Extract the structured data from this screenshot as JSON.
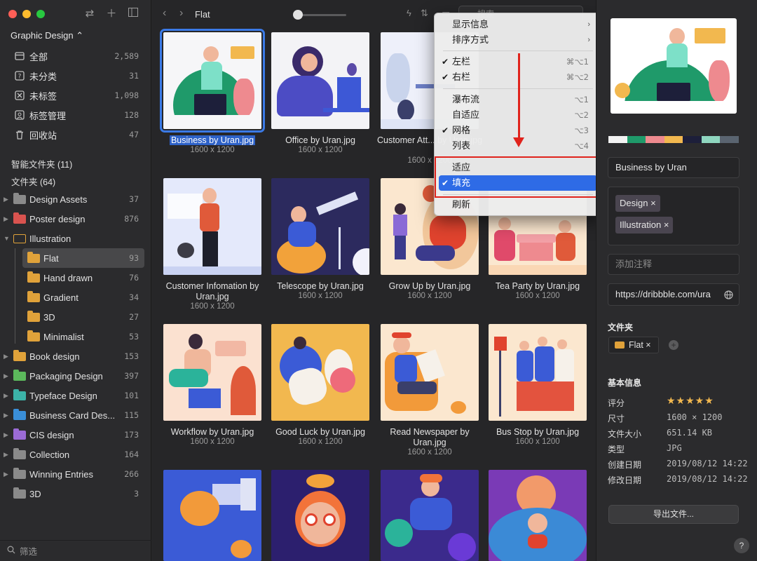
{
  "sidebar": {
    "library": "Graphic Design ⌃",
    "items": [
      {
        "label": "全部",
        "count": "2,589"
      },
      {
        "label": "未分类",
        "count": "31"
      },
      {
        "label": "未标签",
        "count": "1,098"
      },
      {
        "label": "标签管理",
        "count": "128"
      },
      {
        "label": "回收站",
        "count": "47"
      }
    ],
    "smart_folders": "智能文件夹 (11)",
    "folders_title": "文件夹 (64)",
    "folders": [
      {
        "label": "Design Assets",
        "count": "37",
        "color": "#8a8a8a"
      },
      {
        "label": "Poster design",
        "count": "876",
        "color": "#d9534f"
      },
      {
        "label": "Illustration",
        "count": "",
        "color": "#e0a23a"
      },
      {
        "label": "Flat",
        "count": "93",
        "color": "#e0a23a"
      },
      {
        "label": "Hand drawn",
        "count": "76",
        "color": "#e0a23a"
      },
      {
        "label": "Gradient",
        "count": "34",
        "color": "#e0a23a"
      },
      {
        "label": "3D",
        "count": "27",
        "color": "#e0a23a"
      },
      {
        "label": "Minimalist",
        "count": "53",
        "color": "#e0a23a"
      },
      {
        "label": "Book design",
        "count": "153",
        "color": "#e0a23a"
      },
      {
        "label": "Packaging Design",
        "count": "397",
        "color": "#5cb85c"
      },
      {
        "label": "Typeface Design",
        "count": "101",
        "color": "#3cb3a8"
      },
      {
        "label": "Business Card Des...",
        "count": "115",
        "color": "#3a8fd9"
      },
      {
        "label": "CIS design",
        "count": "173",
        "color": "#9b6bd6"
      },
      {
        "label": "Collection",
        "count": "164",
        "color": "#8a8a8a"
      },
      {
        "label": "Winning Entries",
        "count": "266",
        "color": "#8a8a8a"
      },
      {
        "label": "3D",
        "count": "3",
        "color": "#8a8a8a"
      }
    ],
    "filter_placeholder": "筛选"
  },
  "toolbar": {
    "breadcrumb": "Flat",
    "search_placeholder": "搜索"
  },
  "grid": [
    {
      "name": "Business by Uran.jpg",
      "size": "1600 x 1200"
    },
    {
      "name": "Office by Uran.jpg",
      "size": "1600 x 1200"
    },
    {
      "name": "Customer Att... by Uran.jpg",
      "size": "1600 x 1200"
    },
    {
      "name": "",
      "size": ""
    },
    {
      "name": "Customer Infomation by Uran.jpg",
      "size": "1600 x 1200"
    },
    {
      "name": "Telescope by Uran.jpg",
      "size": "1600 x 1200"
    },
    {
      "name": "Grow Up by Uran.jpg",
      "size": "1600 x 1200"
    },
    {
      "name": "Tea Party by Uran.jpg",
      "size": "1600 x 1200"
    },
    {
      "name": "Workflow by Uran.jpg",
      "size": "1600 x 1200"
    },
    {
      "name": "Good Luck by Uran.jpg",
      "size": "1600 x 1200"
    },
    {
      "name": "Read Newspaper by Uran.jpg",
      "size": "1600 x 1200"
    },
    {
      "name": "Bus Stop by Uran.jpg",
      "size": "1600 x 1200"
    }
  ],
  "context_menu": {
    "items": [
      {
        "label": "显示信息",
        "shortcut": "",
        "checked": false,
        "submenu": true
      },
      {
        "label": "排序方式",
        "shortcut": "",
        "checked": false,
        "submenu": true
      },
      {
        "label": "左栏",
        "shortcut": "⌘⌥1",
        "checked": true
      },
      {
        "label": "右栏",
        "shortcut": "⌘⌥2",
        "checked": true
      },
      {
        "label": "瀑布流",
        "shortcut": "⌥1",
        "checked": false
      },
      {
        "label": "自适应",
        "shortcut": "⌥2",
        "checked": false
      },
      {
        "label": "网格",
        "shortcut": "⌥3",
        "checked": true
      },
      {
        "label": "列表",
        "shortcut": "⌥4",
        "checked": false
      },
      {
        "label": "适应",
        "shortcut": "",
        "checked": false
      },
      {
        "label": "填充",
        "shortcut": "",
        "checked": true,
        "highlighted": true
      },
      {
        "label": "刷新",
        "shortcut": "",
        "checked": false
      }
    ]
  },
  "inspector": {
    "palette": [
      "#f2f2f2",
      "#1f9a6a",
      "#ee8a8f",
      "#f2b84f",
      "#1d1f3a",
      "#8fd6bf",
      "#5a6470"
    ],
    "title": "Business by Uran",
    "tags": [
      "Design ×",
      "Illustration ×"
    ],
    "note_placeholder": "添加注释",
    "url": "https://dribbble.com/ura",
    "folder_title": "文件夹",
    "folder_chip": "Flat ×",
    "basic_info_title": "基本信息",
    "rating_label": "评分",
    "rating": 5,
    "stars": "★★★★★",
    "info": [
      {
        "k": "尺寸",
        "v": "1600 × 1200"
      },
      {
        "k": "文件大小",
        "v": "651.14 KB"
      },
      {
        "k": "类型",
        "v": "JPG"
      },
      {
        "k": "创建日期",
        "v": "2019/08/12 14:22"
      },
      {
        "k": "修改日期",
        "v": "2019/08/12 14:22"
      }
    ],
    "export_label": "导出文件...",
    "help": "?"
  }
}
